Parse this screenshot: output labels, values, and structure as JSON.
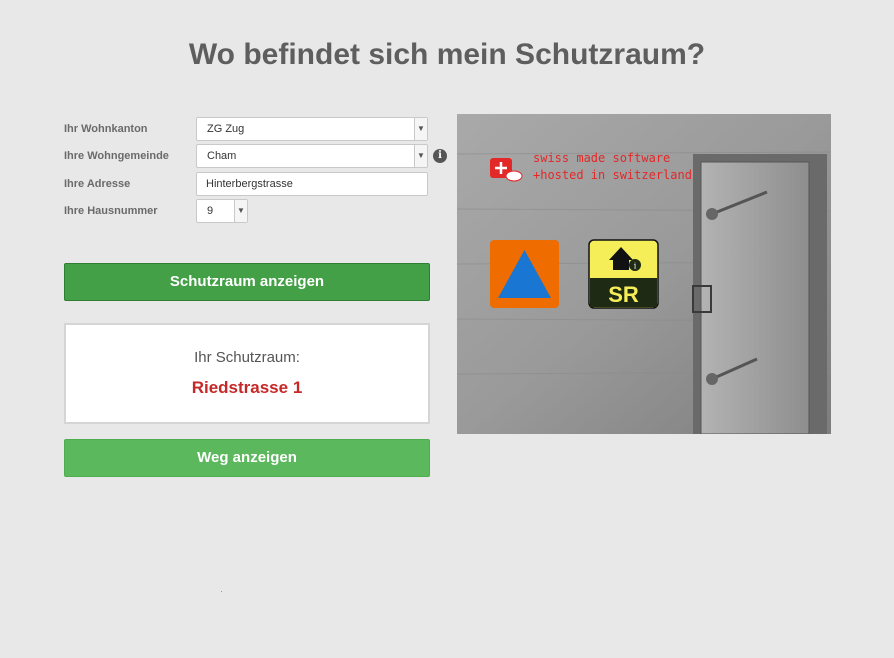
{
  "page": {
    "title": "Wo befindet sich mein Schutzraum?"
  },
  "form": {
    "canton": {
      "label": "Ihr Wohnkanton",
      "value": "ZG Zug"
    },
    "municipality": {
      "label": "Ihre Wohngemeinde",
      "value": "Cham"
    },
    "address": {
      "label": "Ihre Adresse",
      "value": "Hinterbergstrasse"
    },
    "housenumber": {
      "label": "Ihre Hausnummer",
      "value": "9"
    }
  },
  "buttons": {
    "show_shelter": "Schutzraum anzeigen",
    "show_route": "Weg anzeigen"
  },
  "result": {
    "label": "Ihr Schutzraum:",
    "value": "Riedstrasse 1"
  },
  "image": {
    "badge_line1": "swiss made software",
    "badge_line2": "+hosted in switzerland",
    "sr_text": "SR",
    "colors": {
      "civil_orange": "#ef6c00",
      "civil_blue": "#1976d2",
      "sr_yellow": "#f5ee58",
      "sr_dark": "#1f2a14",
      "badge_red": "#e32828"
    }
  },
  "icons": {
    "info": "info-icon",
    "select_arrow": "chevron-down-icon"
  }
}
